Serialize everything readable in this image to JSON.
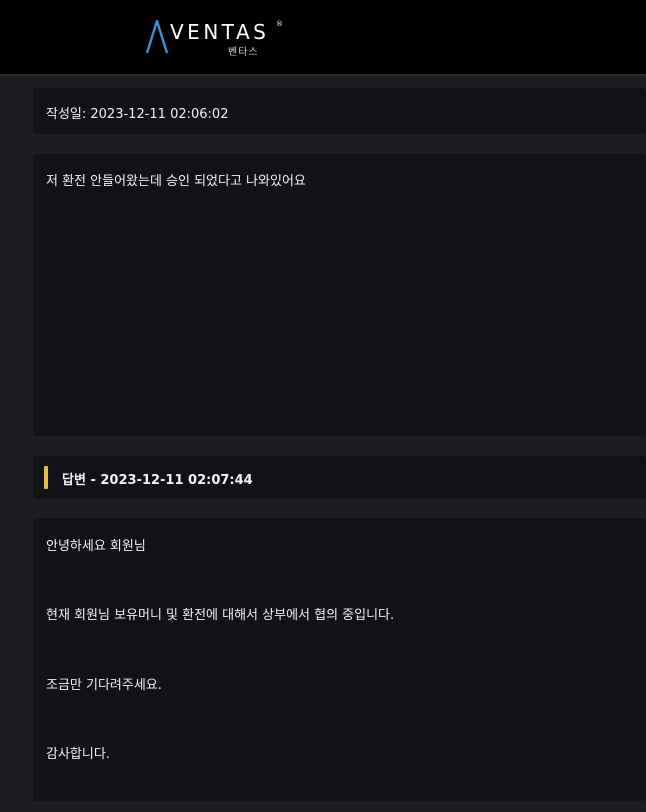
{
  "header": {
    "logo_text": "VENTAS",
    "logo_reg": "®",
    "logo_sub": "벤타스",
    "accent_color": "#3b8fd6"
  },
  "post": {
    "date_label": "작성일: 2023-12-11 02:06:02",
    "content": "저 환전 안들어왔는데 승인 되었다고 나와있어요"
  },
  "reply": {
    "header_label": "답변 - 2023-12-11 02:07:44",
    "accent_color": "#e8b84a",
    "lines": [
      "안녕하세요 회원님",
      "현재 회원님 보유머니 및 환전에 대해서 상부에서 협의 중입니다.",
      "조금만 기다려주세요.",
      "감사합니다."
    ]
  }
}
